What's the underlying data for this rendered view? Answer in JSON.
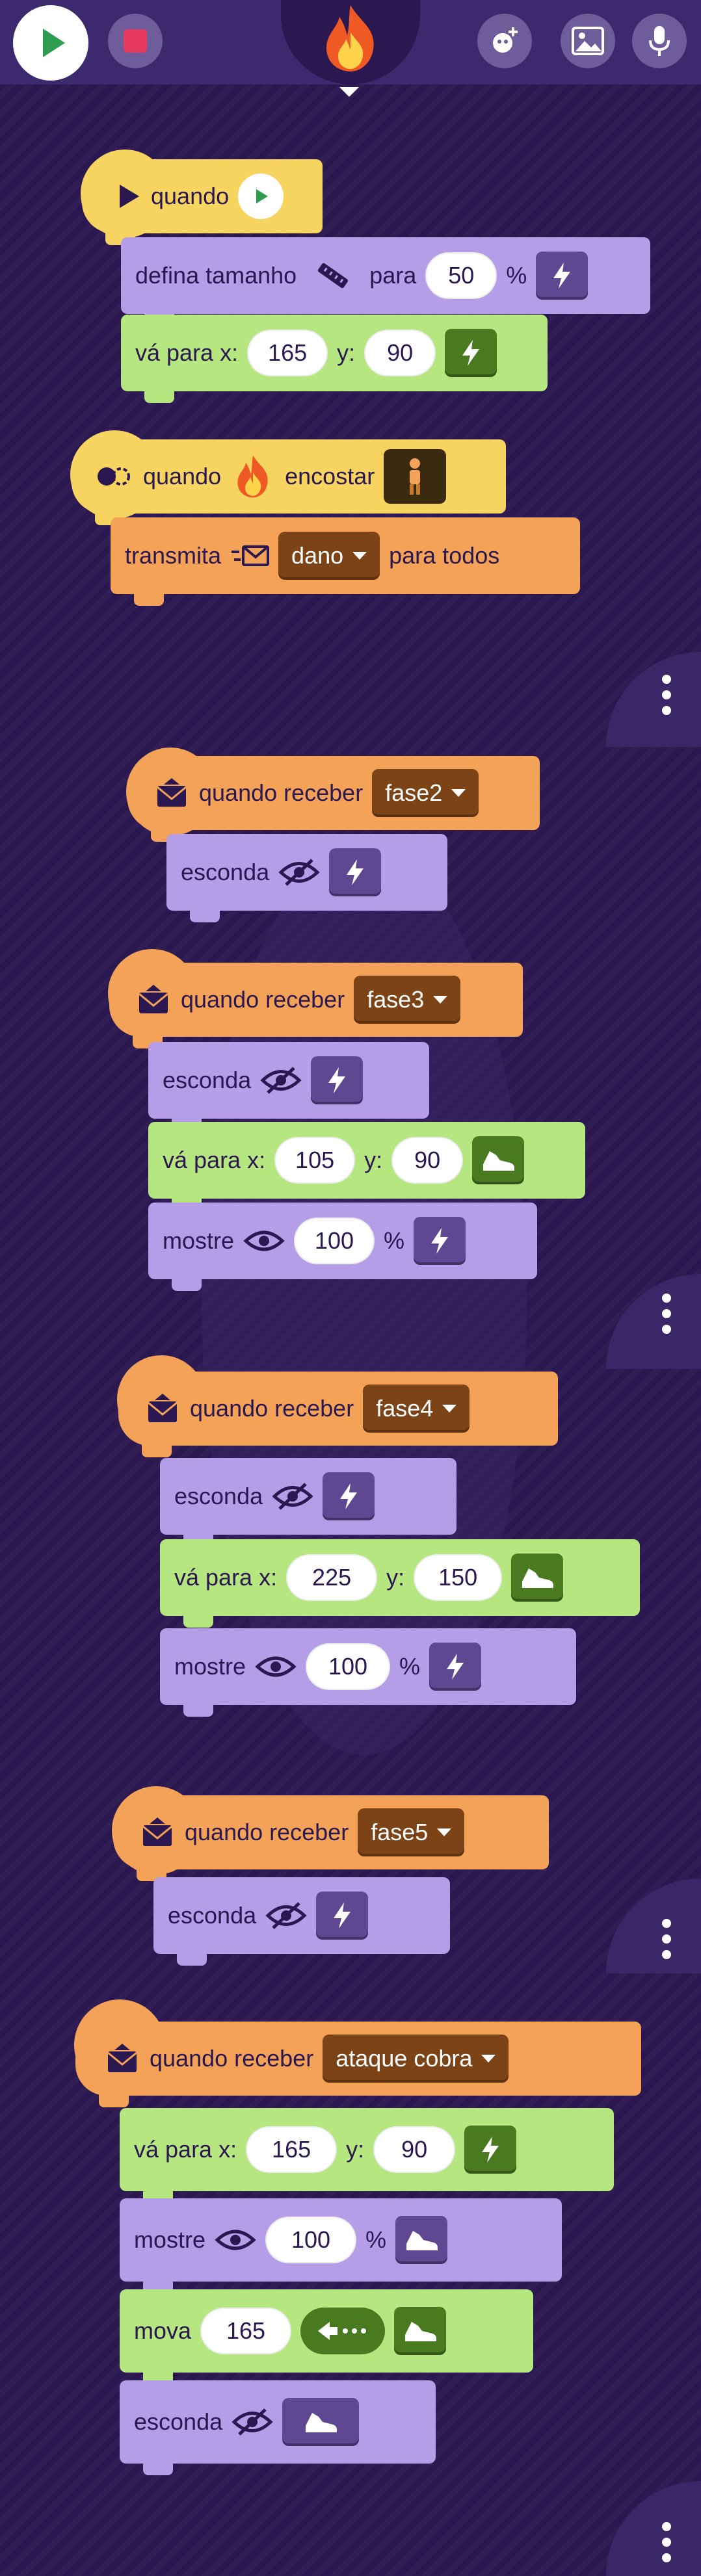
{
  "topbar": {
    "play_icon": "play-icon",
    "stop_icon": "stop-icon",
    "stage_icon": "fire-icon",
    "add_sprite_icon": "add-character-icon",
    "background_icon": "image-icon",
    "sound_icon": "microphone-icon",
    "colors": {
      "bar": "#3d2a6e",
      "play": "#2e9d4f",
      "stop": "#e63b5f"
    }
  },
  "scripts": [
    {
      "hat": {
        "label": "quando",
        "trigger": "green-flag"
      },
      "blocks": [
        {
          "type": "set_size",
          "label": "defina tamanho",
          "to": "para",
          "value": "50",
          "unit": "%"
        },
        {
          "type": "goto",
          "label": "vá para x:",
          "x": "165",
          "ylabel": "y:",
          "y": "90"
        }
      ]
    },
    {
      "hat": {
        "label": "quando",
        "middle": "encostar"
      },
      "blocks": [
        {
          "type": "broadcast",
          "label": "transmita",
          "message": "dano",
          "suffix": "para todos"
        }
      ]
    },
    {
      "hat": {
        "label": "quando receber",
        "message": "fase2"
      },
      "blocks": [
        {
          "type": "hide",
          "label": "esconda"
        }
      ]
    },
    {
      "hat": {
        "label": "quando receber",
        "message": "fase3"
      },
      "blocks": [
        {
          "type": "hide",
          "label": "esconda"
        },
        {
          "type": "goto",
          "label": "vá para x:",
          "x": "105",
          "ylabel": "y:",
          "y": "90"
        },
        {
          "type": "show",
          "label": "mostre",
          "value": "100",
          "unit": "%"
        }
      ]
    },
    {
      "hat": {
        "label": "quando receber",
        "message": "fase4"
      },
      "blocks": [
        {
          "type": "hide",
          "label": "esconda"
        },
        {
          "type": "goto",
          "label": "vá para x:",
          "x": "225",
          "ylabel": "y:",
          "y": "150"
        },
        {
          "type": "show",
          "label": "mostre",
          "value": "100",
          "unit": "%"
        }
      ]
    },
    {
      "hat": {
        "label": "quando receber",
        "message": "fase5"
      },
      "blocks": [
        {
          "type": "hide",
          "label": "esconda"
        }
      ]
    },
    {
      "hat": {
        "label": "quando receber",
        "message": "ataque cobra"
      },
      "blocks": [
        {
          "type": "goto",
          "label": "vá para x:",
          "x": "165",
          "ylabel": "y:",
          "y": "90"
        },
        {
          "type": "show",
          "label": "mostre",
          "value": "100",
          "unit": "%"
        },
        {
          "type": "move",
          "label": "mova",
          "value": "165"
        },
        {
          "type": "hide",
          "label": "esconda"
        }
      ]
    }
  ]
}
